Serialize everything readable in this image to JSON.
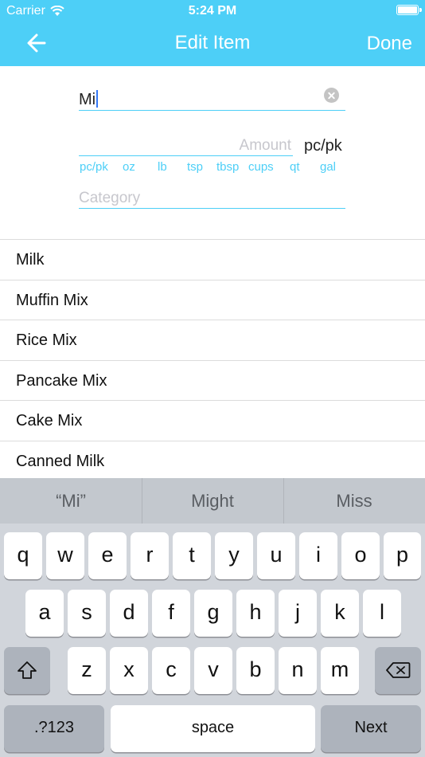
{
  "status_bar": {
    "carrier": "Carrier",
    "time": "5:24 PM"
  },
  "nav": {
    "title": "Edit Item",
    "done_label": "Done"
  },
  "form": {
    "name_value": "Mi",
    "amount_placeholder": "Amount",
    "unit_selected": "pc/pk",
    "unit_options": [
      "pc/pk",
      "oz",
      "lb",
      "tsp",
      "tbsp",
      "cups",
      "qt",
      "gal"
    ],
    "category_placeholder": "Category"
  },
  "suggestions_list": [
    "Milk",
    "Muffin Mix",
    "Rice Mix",
    "Pancake Mix",
    "Cake Mix",
    "Canned Milk"
  ],
  "keyboard": {
    "predictions": [
      "“Mi”",
      "Might",
      "Miss"
    ],
    "row1": [
      "q",
      "w",
      "e",
      "r",
      "t",
      "y",
      "u",
      "i",
      "o",
      "p"
    ],
    "row2": [
      "a",
      "s",
      "d",
      "f",
      "g",
      "h",
      "j",
      "k",
      "l"
    ],
    "row3": [
      "z",
      "x",
      "c",
      "v",
      "b",
      "n",
      "m"
    ],
    "numbers_label": ".?123",
    "space_label": "space",
    "next_label": "Next"
  },
  "colors": {
    "accent": "#4dcff7",
    "keyboard_bg": "#d1d5db",
    "caret": "#3478f6"
  }
}
